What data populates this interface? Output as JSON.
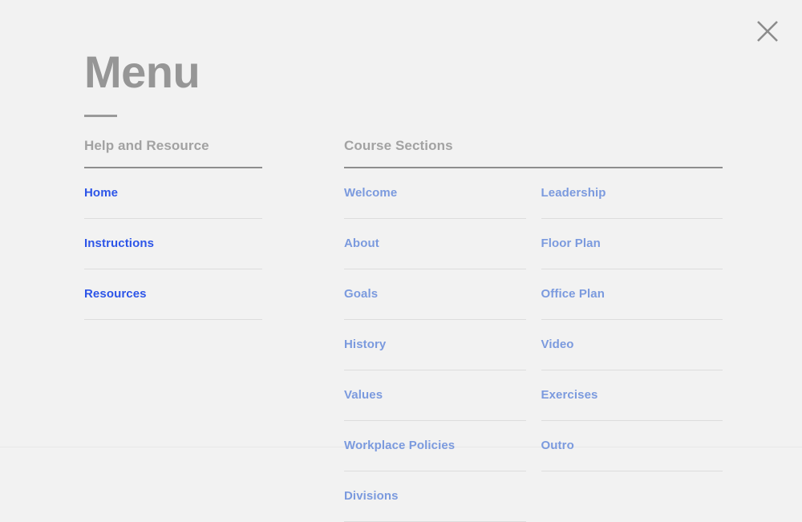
{
  "window": {
    "background_color": "#f2f2f2"
  },
  "close_button": {
    "icon": "close-icon",
    "label": "Close",
    "color": "#8c8c8c"
  },
  "header": {
    "title": "Menu",
    "title_color": "#969696",
    "rule_color": "#9a9a9a"
  },
  "groups": [
    {
      "id": "help-and-resource",
      "header": "Help and Resource",
      "header_color": "#a2a2a2",
      "link_color": "#2d55e8",
      "columns": [
        {
          "items": [
            {
              "label": "Home"
            },
            {
              "label": "Instructions"
            },
            {
              "label": "Resources"
            }
          ]
        }
      ]
    },
    {
      "id": "course-sections",
      "header": "Course Sections",
      "header_color": "#a2a2a2",
      "link_color": "#7b9ade",
      "columns": [
        {
          "items": [
            {
              "label": "Welcome"
            },
            {
              "label": "About"
            },
            {
              "label": "Goals"
            },
            {
              "label": "History"
            },
            {
              "label": "Values"
            },
            {
              "label": "Workplace Policies"
            },
            {
              "label": "Divisions"
            }
          ]
        },
        {
          "items": [
            {
              "label": "Leadership"
            },
            {
              "label": "Floor Plan"
            },
            {
              "label": "Office Plan"
            },
            {
              "label": "Video"
            },
            {
              "label": "Exercises"
            },
            {
              "label": "Outro"
            }
          ]
        }
      ]
    }
  ]
}
